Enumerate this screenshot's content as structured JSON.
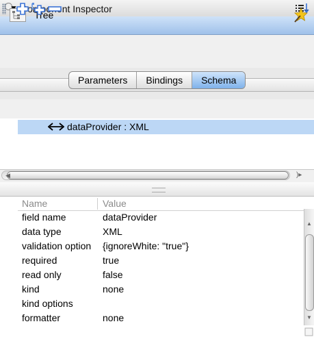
{
  "panel": {
    "title": "Component Inspector",
    "collapse_glyph": "▼"
  },
  "component": {
    "name": "Tree"
  },
  "tabs": [
    {
      "label": "Parameters",
      "active": false
    },
    {
      "label": "Bindings",
      "active": false
    },
    {
      "label": "Schema",
      "active": true
    }
  ],
  "schema": {
    "items": [
      {
        "label": "dataProvider : XML",
        "icon": "bidirectional-arrow-icon",
        "selected": true
      }
    ]
  },
  "properties": {
    "columns": {
      "name": "Name",
      "value": "Value"
    },
    "rows": [
      {
        "name": "field name",
        "value": "dataProvider"
      },
      {
        "name": "data type",
        "value": "XML"
      },
      {
        "name": "validation option",
        "value": "{ignoreWhite: \"true\"}"
      },
      {
        "name": "required",
        "value": "true"
      },
      {
        "name": "read only",
        "value": "false"
      },
      {
        "name": "kind",
        "value": "none"
      },
      {
        "name": "kind options",
        "value": ""
      },
      {
        "name": "formatter",
        "value": "none"
      }
    ]
  },
  "colors": {
    "panel_header": "#9fc1ea",
    "selection": "#bcd7f5",
    "active_tab": "#7fb2ea",
    "add_icon": "#3b73d6"
  }
}
